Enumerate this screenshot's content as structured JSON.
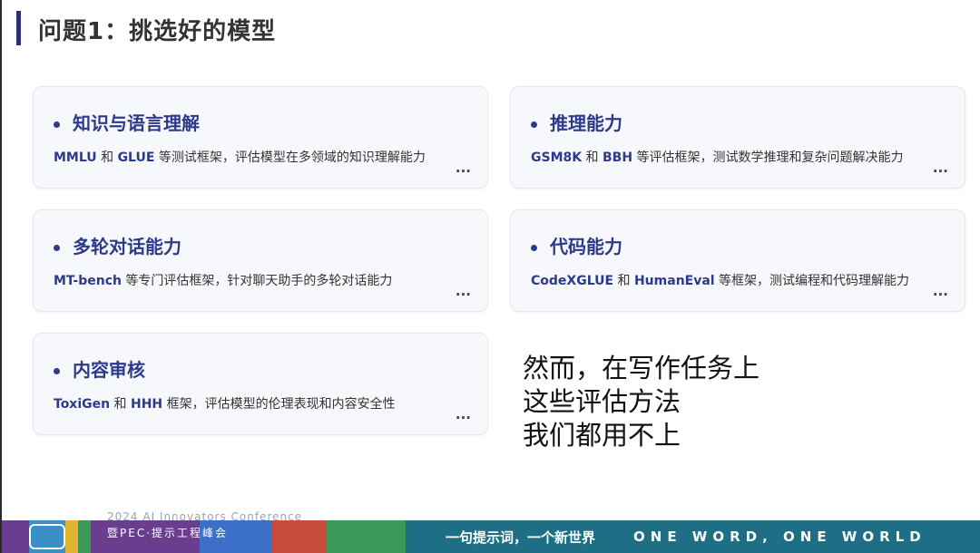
{
  "slide": {
    "title": "问题1：挑选好的模型",
    "cards": [
      {
        "title": "知识与语言理解",
        "desc_bold_1": "MMLU",
        "desc_mid_1": " 和 ",
        "desc_bold_2": "GLUE",
        "desc_rest": " 等测试框架，评估模型在多领域的知识理解能力",
        "more": "..."
      },
      {
        "title": "推理能力",
        "desc_bold_1": "GSM8K",
        "desc_mid_1": " 和 ",
        "desc_bold_2": "BBH",
        "desc_rest": " 等评估框架，测试数学推理和复杂问题解决能力",
        "more": "..."
      },
      {
        "title": "多轮对话能力",
        "desc_bold_1": "MT-bench",
        "desc_mid_1": "",
        "desc_bold_2": "",
        "desc_rest": " 等专门评估框架，针对聊天助手的多轮对话能力",
        "more": "..."
      },
      {
        "title": "代码能力",
        "desc_bold_1": "CodeXGLUE",
        "desc_mid_1": " 和 ",
        "desc_bold_2": "HumanEval",
        "desc_rest": " 等框架，测试编程和代码理解能力",
        "more": "..."
      },
      {
        "title": "内容审核",
        "desc_bold_1": "ToxiGen",
        "desc_mid_1": " 和 ",
        "desc_bold_2": "HHH",
        "desc_rest": " 框架，评估模型的伦理表现和内容安全性",
        "more": "..."
      }
    ],
    "note_lines": [
      "然而，在写作任务上",
      "这些评估方法",
      "我们都用不上"
    ]
  },
  "footer": {
    "conference_en": "2024 AI Innovators Conference",
    "conference_cn": "暨PEC·提示工程峰会",
    "slogan_cn": "一句提示词，一个新世界",
    "slogan_en": "ONE WORD, ONE WORLD",
    "colors": {
      "left_bar": "#c94b3a",
      "right_bar": "#1e6f86"
    }
  },
  "colors": {
    "accent": "#2d3a8c",
    "card_bg": "#f7f8fb"
  }
}
